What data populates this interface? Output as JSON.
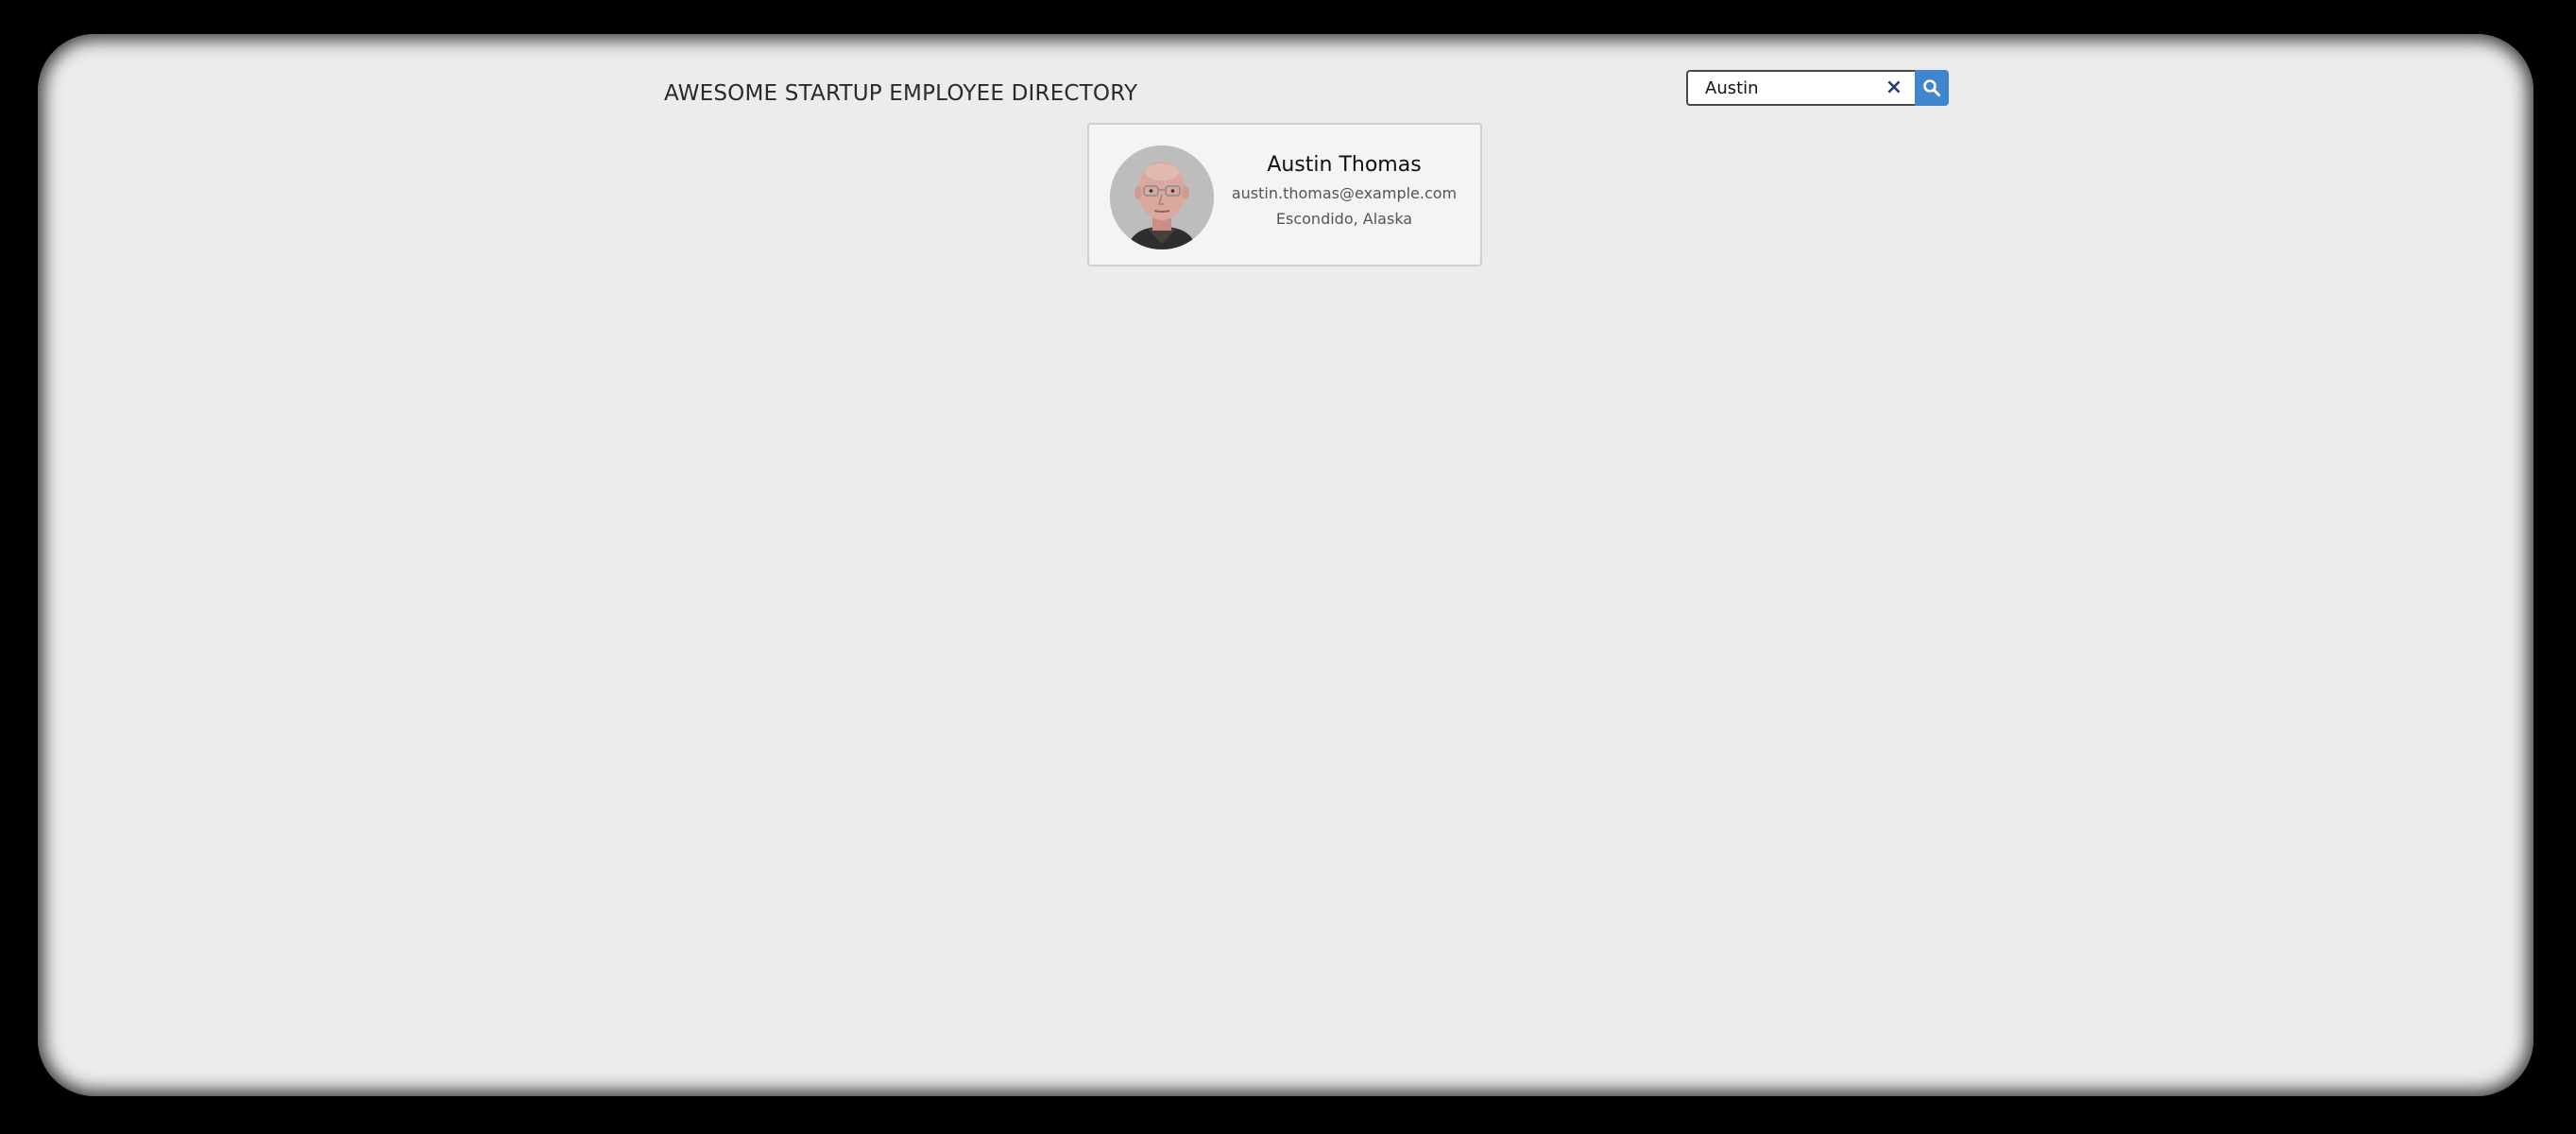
{
  "header": {
    "title": "AWESOME STARTUP EMPLOYEE DIRECTORY"
  },
  "search": {
    "value": "Austin",
    "clear_symbol": "×",
    "clear_icon": "close-icon",
    "submit_icon": "search-icon",
    "accent_color": "#3f86cf"
  },
  "results": [
    {
      "name": "Austin Thomas",
      "email": "austin.thomas@example.com",
      "location": "Escondido, Alaska",
      "avatar_icon": "avatar-photo"
    }
  ]
}
